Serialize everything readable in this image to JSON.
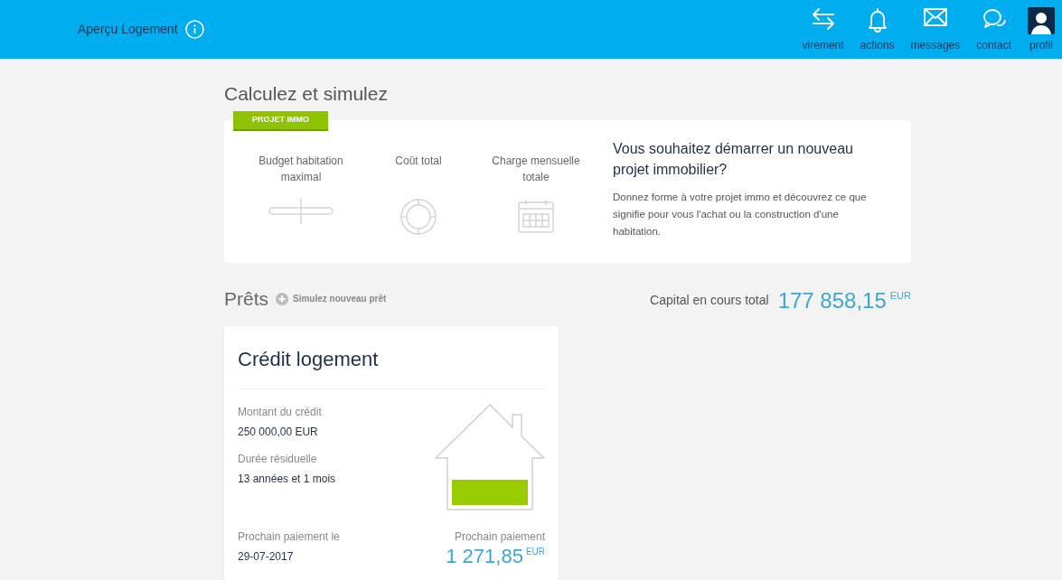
{
  "header": {
    "title": "Aperçu Logement",
    "nav": [
      {
        "label": "virement",
        "kind": "transfer"
      },
      {
        "label": "actions",
        "kind": "bell"
      },
      {
        "label": "messages",
        "kind": "mail"
      },
      {
        "label": "contact",
        "kind": "chat"
      },
      {
        "label": "profil",
        "kind": "avatar"
      }
    ]
  },
  "simulate": {
    "title": "Calculez et simulez",
    "tag": "PROJET IMMO",
    "features": [
      {
        "label": "Budget habitation maximal",
        "kind": "slider"
      },
      {
        "label": "Coût total",
        "kind": "ring"
      },
      {
        "label": "Charge mensuelle totale",
        "kind": "calendar"
      }
    ],
    "promo_title": "Vous souhaitez démarrer un nouveau projet immobilier?",
    "promo_text": "Donnez forme à votre projet immo et découvrez ce que signifie pour vous l'achat ou la construction d'une habitation."
  },
  "loans": {
    "title": "Prêts",
    "new_loan": "Simulez nouveau prêt",
    "total_label": "Capital en cours total",
    "total_value": "177 858,15",
    "total_currency": "EUR",
    "cards": [
      {
        "title": "Crédit logement",
        "amount_label": "Montant du crédit",
        "amount": "250 000,00 EUR",
        "duration_label": "Durée résiduelle",
        "duration": "13 années et 1 mois",
        "next_date_label": "Prochain paiement le",
        "next_date": "29-07-2017",
        "next_amount_label": "Prochain paiement",
        "next_amount": "1 271,85",
        "next_currency": "EUR"
      }
    ]
  }
}
